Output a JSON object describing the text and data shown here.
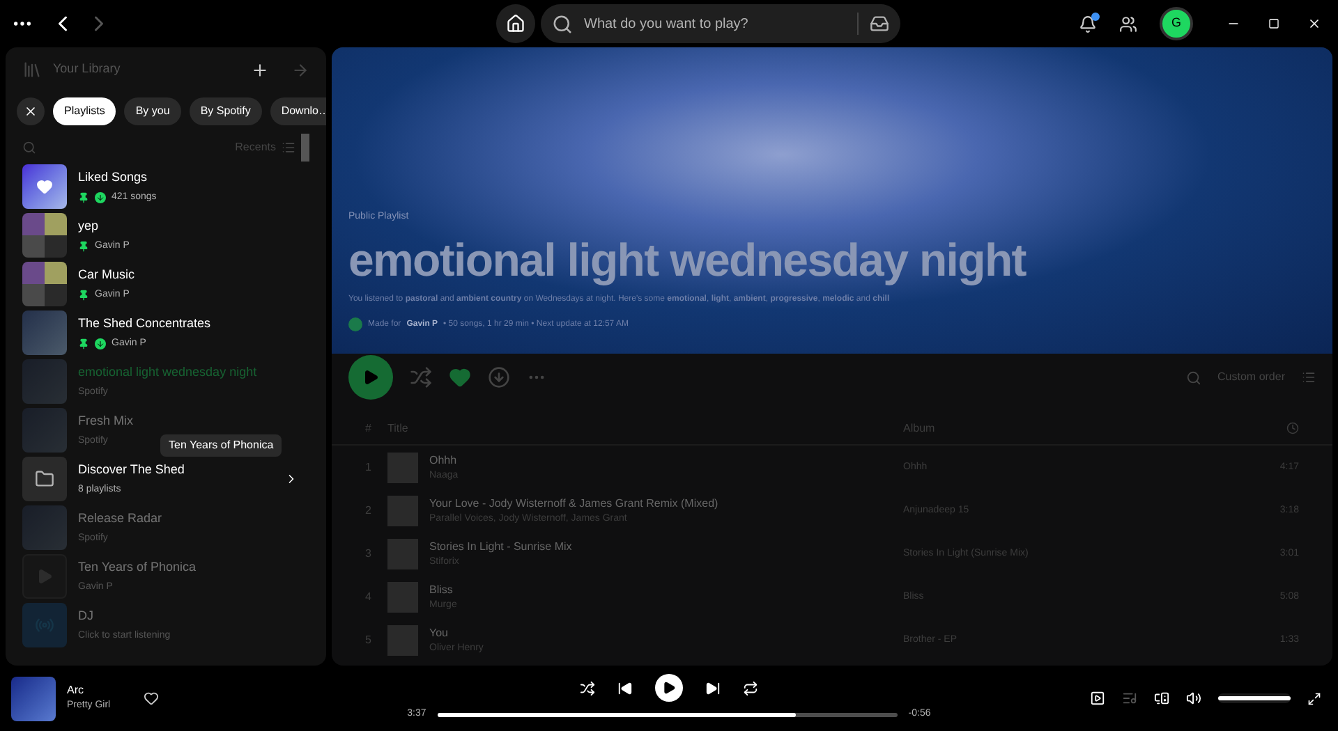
{
  "search": {
    "placeholder": "What do you want to play?"
  },
  "profile": {
    "initial": "G"
  },
  "notifications": {
    "unread": true
  },
  "library": {
    "title": "Your Library",
    "filters": [
      {
        "label": "Playlists",
        "selected": true
      },
      {
        "label": "By you",
        "selected": false
      },
      {
        "label": "By Spotify",
        "selected": false
      },
      {
        "label": "Downlo…",
        "selected": false
      }
    ],
    "sort": "Recents",
    "items": [
      {
        "kind": "liked",
        "title": "Liked Songs",
        "subtitle": "421 songs",
        "pinned": true,
        "downloaded": true,
        "selected": false,
        "dimmed": false
      },
      {
        "kind": "mosaic",
        "title": "yep",
        "subtitle": "Gavin P",
        "pinned": true,
        "selected": false,
        "dimmed": false
      },
      {
        "kind": "mosaic",
        "title": "Car Music",
        "subtitle": "Gavin P",
        "pinned": true,
        "selected": false,
        "dimmed": false
      },
      {
        "kind": "cover",
        "title": "The Shed Concentrates",
        "subtitle": "Gavin P",
        "pinned": true,
        "downloaded": true,
        "selected": false,
        "dimmed": false
      },
      {
        "kind": "cover",
        "title": "emotional light wednesday night",
        "subtitle": "Spotify",
        "selected": true,
        "dimmed": true
      },
      {
        "kind": "cover",
        "title": "Fresh Mix",
        "subtitle": "Spotify",
        "selected": false,
        "dimmed": true
      },
      {
        "kind": "folder",
        "title": "Discover The Shed",
        "subtitle": "8 playlists",
        "selected": false,
        "dimmed": false
      },
      {
        "kind": "cover",
        "title": "Release Radar",
        "subtitle": "Spotify",
        "selected": false,
        "dimmed": true
      },
      {
        "kind": "play",
        "title": "Ten Years of Phonica",
        "subtitle": "Gavin P",
        "selected": false,
        "dimmed": true
      },
      {
        "kind": "dj",
        "title": "DJ",
        "subtitle": "Click to start listening",
        "selected": false,
        "dimmed": true
      }
    ],
    "drag_label": "Ten Years of Phonica"
  },
  "playlist": {
    "type": "Public Playlist",
    "title": "emotional light wednesday night",
    "description": "You listened to **pastoral** and **ambient country** on Wednesdays at night. Here's some **emotional**, **light**, **ambient**, **progressive**, **melodic** and **chill**",
    "owner": "Gavin P",
    "meta": "• 50 songs, 1 hr 29 min • Next update at 12:57 AM",
    "made_for": "Made for",
    "liked": true,
    "sort": "Custom order",
    "columns": [
      "#",
      "Title",
      "Album"
    ],
    "tracks": [
      {
        "number": "1",
        "title": "Ohhh",
        "artist": "Naaga",
        "album": "Ohhh",
        "duration": "4:17"
      },
      {
        "number": "2",
        "title": "Your Love - Jody Wisternoff & James Grant Remix (Mixed)",
        "artist": "Parallel Voices, Jody Wisternoff, James Grant",
        "album": "Anjunadeep 15",
        "duration": "3:18"
      },
      {
        "number": "3",
        "title": "Stories In Light - Sunrise Mix",
        "artist": "Stiforix",
        "album": "Stories In Light (Sunrise Mix)",
        "duration": "3:01"
      },
      {
        "number": "4",
        "title": "Bliss",
        "artist": "Murge",
        "album": "Bliss",
        "duration": "5:08"
      },
      {
        "number": "5",
        "title": "You",
        "artist": "Oliver Henry",
        "album": "Brother - EP",
        "duration": "1:33"
      }
    ]
  },
  "player": {
    "title": "Arc",
    "artist": "Pretty Girl",
    "liked": false,
    "elapsed": "3:37",
    "remaining": "-0:56",
    "progress": {
      "level": 0.78
    },
    "volume": {
      "level": 1.0
    }
  }
}
